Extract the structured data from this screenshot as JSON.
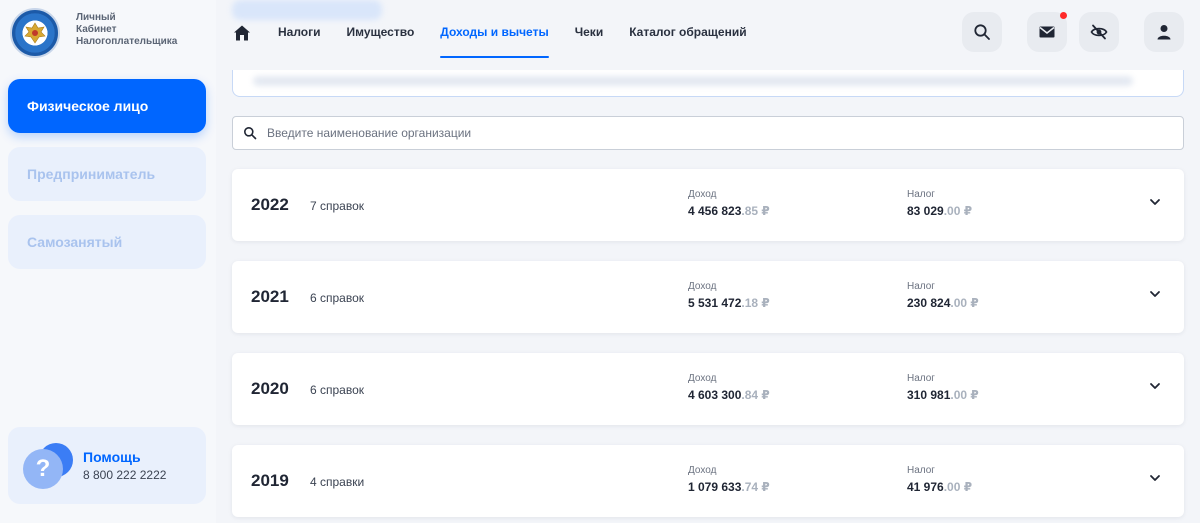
{
  "app": {
    "logo_lines": [
      "Личный",
      "Кабинет",
      "Налогоплательщика"
    ]
  },
  "sidebar": {
    "items": [
      {
        "label": "Физическое лицо",
        "active": true
      },
      {
        "label": "Предприниматель",
        "active": false
      },
      {
        "label": "Самозанятый",
        "active": false
      }
    ],
    "help": {
      "title": "Помощь",
      "phone": "8 800 222 2222",
      "icon": "question-icon"
    }
  },
  "nav": {
    "home_icon": "home-icon",
    "items": [
      {
        "label": "Налоги",
        "active": false
      },
      {
        "label": "Имущество",
        "active": false
      },
      {
        "label": "Доходы и вычеты",
        "active": true
      },
      {
        "label": "Чеки",
        "active": false
      },
      {
        "label": "Каталог обращений",
        "active": false
      }
    ],
    "actions": [
      "search-icon",
      "mail-icon",
      "eye-off-icon",
      "user-icon"
    ]
  },
  "search": {
    "placeholder": "Введите наименование организации",
    "value": ""
  },
  "labels": {
    "income": "Доход",
    "tax": "Налог"
  },
  "years": [
    {
      "year": "2022",
      "count": "7 справок",
      "income_main": "4 456 823",
      "income_kop": ".85 ₽",
      "tax_main": "83 029",
      "tax_kop": ".00 ₽"
    },
    {
      "year": "2021",
      "count": "6 справок",
      "income_main": "5 531 472",
      "income_kop": ".18 ₽",
      "tax_main": "230 824",
      "tax_kop": ".00 ₽"
    },
    {
      "year": "2020",
      "count": "6 справок",
      "income_main": "4 603 300",
      "income_kop": ".84 ₽",
      "tax_main": "310 981",
      "tax_kop": ".00 ₽"
    },
    {
      "year": "2019",
      "count": "4 справки",
      "income_main": "1 079 633",
      "income_kop": ".74 ₽",
      "tax_main": "41 976",
      "tax_kop": ".00 ₽"
    }
  ],
  "colors": {
    "accent": "#0066ff",
    "notification": "#ff2a2a",
    "sidebar_inactive_bg": "#e9f0fc"
  }
}
